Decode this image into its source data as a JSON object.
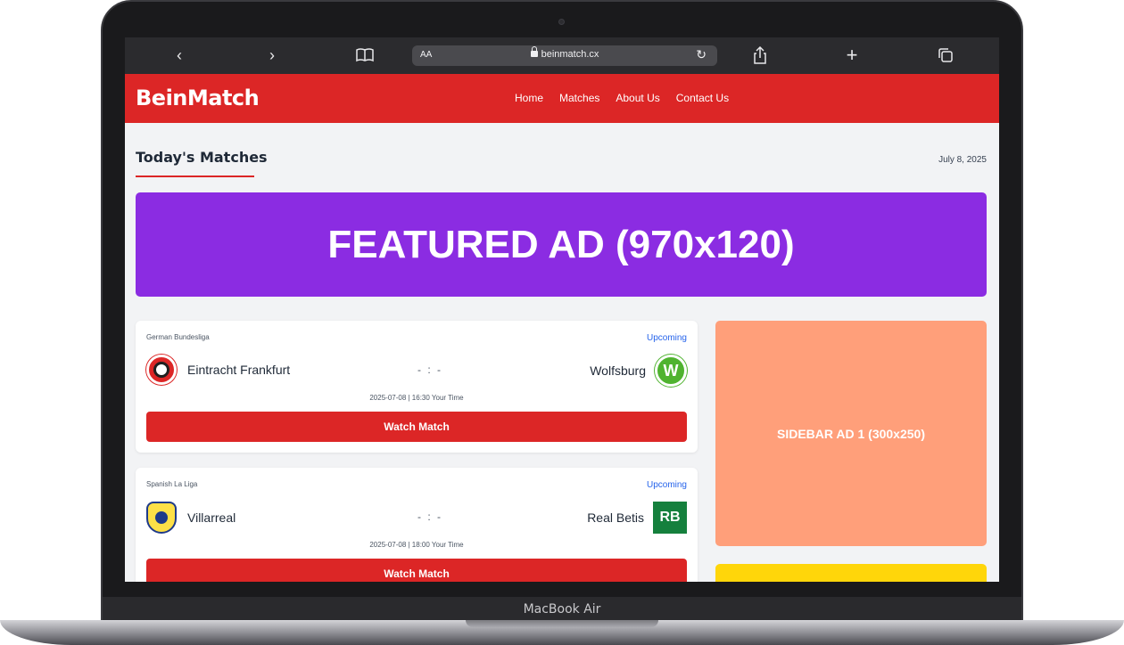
{
  "device": {
    "label": "MacBook Air"
  },
  "browser": {
    "back_icon": "‹",
    "forward_icon": "›",
    "text_size": "AA",
    "url": "beinmatch.cx",
    "reload_icon": "↻",
    "share_icon": "⇧",
    "new_tab_icon": "+",
    "tabs_icon": "❐"
  },
  "site": {
    "logo": "BeinMatch",
    "nav": [
      "Home",
      "Matches",
      "About Us",
      "Contact Us"
    ],
    "accent": "#dc2626"
  },
  "page": {
    "title": "Today's Matches",
    "date": "July 8, 2025",
    "featured_ad": "FEATURED AD (970x120)",
    "sidebar_ad_1": "SIDEBAR AD 1 (300x250)",
    "sidebar_ad_2": ""
  },
  "matches": [
    {
      "league": "German Bundesliga",
      "status": "Upcoming",
      "home": "Eintracht Frankfurt",
      "away": "Wolfsburg",
      "away_crest_text": "W",
      "score": "- : -",
      "kickoff": "2025-07-08 | 16:30 Your Time",
      "button": "Watch Match"
    },
    {
      "league": "Spanish La Liga",
      "status": "Upcoming",
      "home": "Villarreal",
      "away": "Real Betis",
      "away_crest_text": "RB",
      "score": "- : -",
      "kickoff": "2025-07-08 | 18:00 Your Time",
      "button": "Watch Match"
    }
  ]
}
